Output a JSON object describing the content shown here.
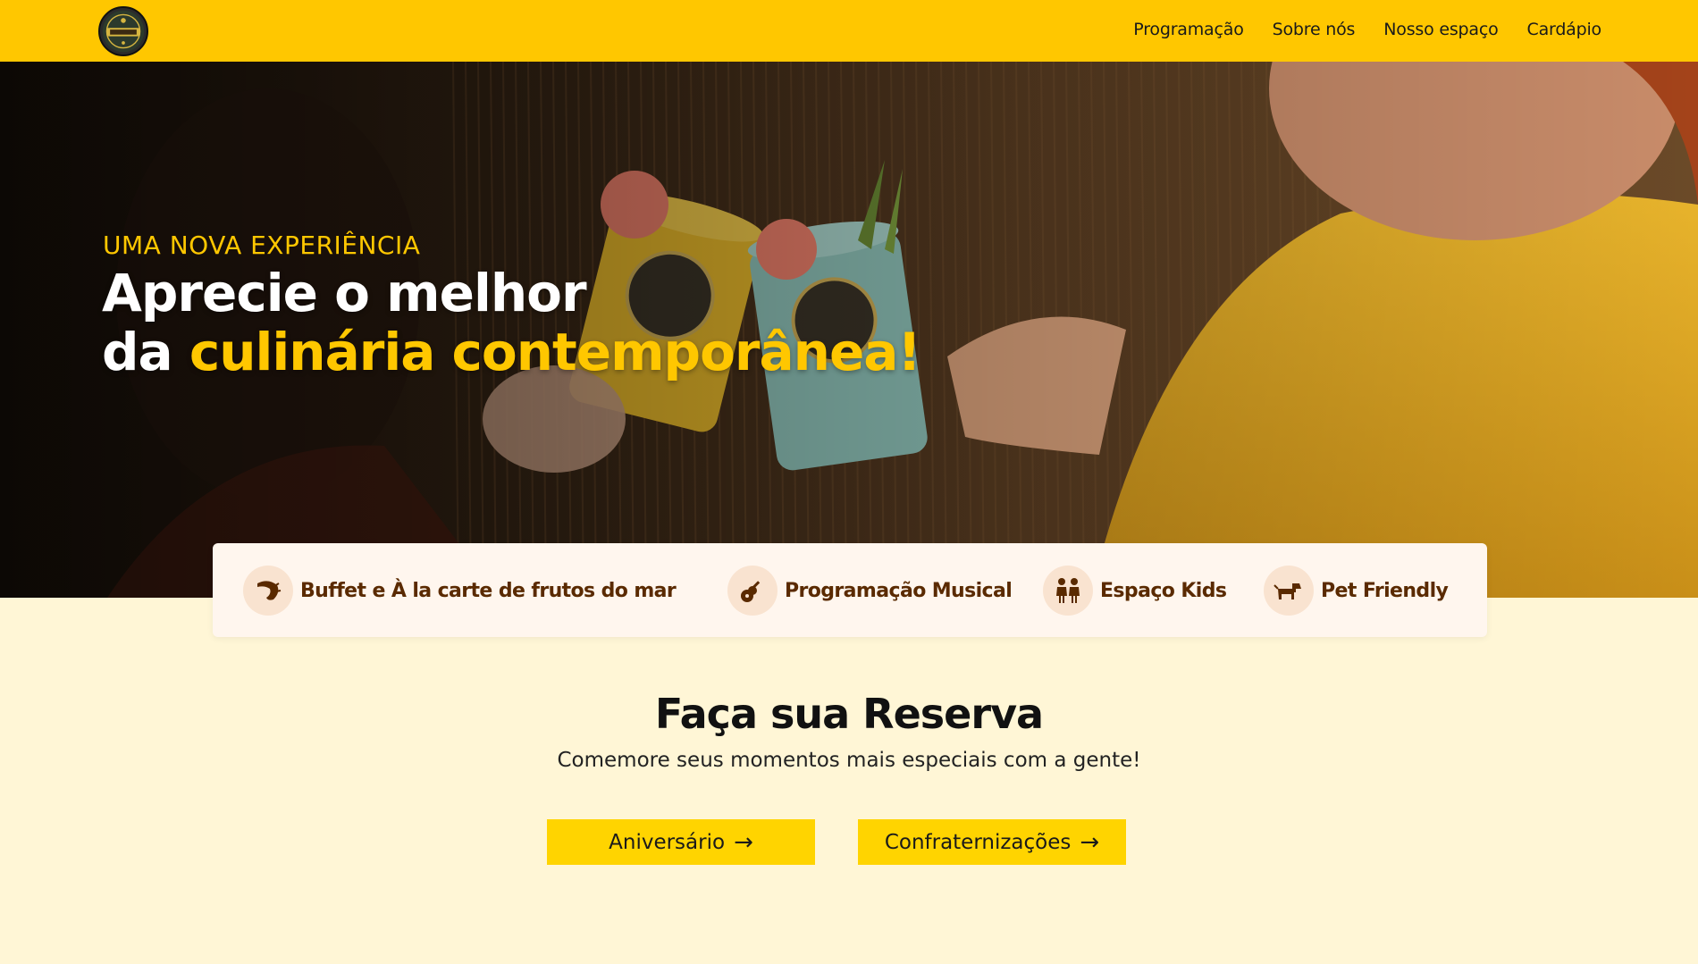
{
  "header": {
    "logo_alt": "Restaurante Manati",
    "nav": [
      "Programação",
      "Sobre nós",
      "Nosso espaço",
      "Cardápio"
    ]
  },
  "hero": {
    "eyebrow": "UMA NOVA EXPERIÊNCIA",
    "headline_line1": "Aprecie o melhor",
    "headline_line2_prefix": "da ",
    "headline_line2_highlight": "culinária contemporânea!"
  },
  "features": [
    {
      "label": "Buffet e À la carte de frutos do mar",
      "icon": "shrimp-icon"
    },
    {
      "label": "Programação Musical",
      "icon": "guitar-icon"
    },
    {
      "label": "Espaço Kids",
      "icon": "kids-icon"
    },
    {
      "label": "Pet Friendly",
      "icon": "dog-icon"
    }
  ],
  "reservation": {
    "title": "Faça sua Reserva",
    "subtitle": "Comemore seus momentos mais especiais com a gente!",
    "buttons": [
      {
        "label": "Aniversário",
        "arrow": "→"
      },
      {
        "label": "Confraternizações",
        "arrow": "→"
      }
    ]
  },
  "colors": {
    "brand_yellow": "#ffc700",
    "page_background": "#fff6d6",
    "feature_text": "#5a2a00"
  }
}
